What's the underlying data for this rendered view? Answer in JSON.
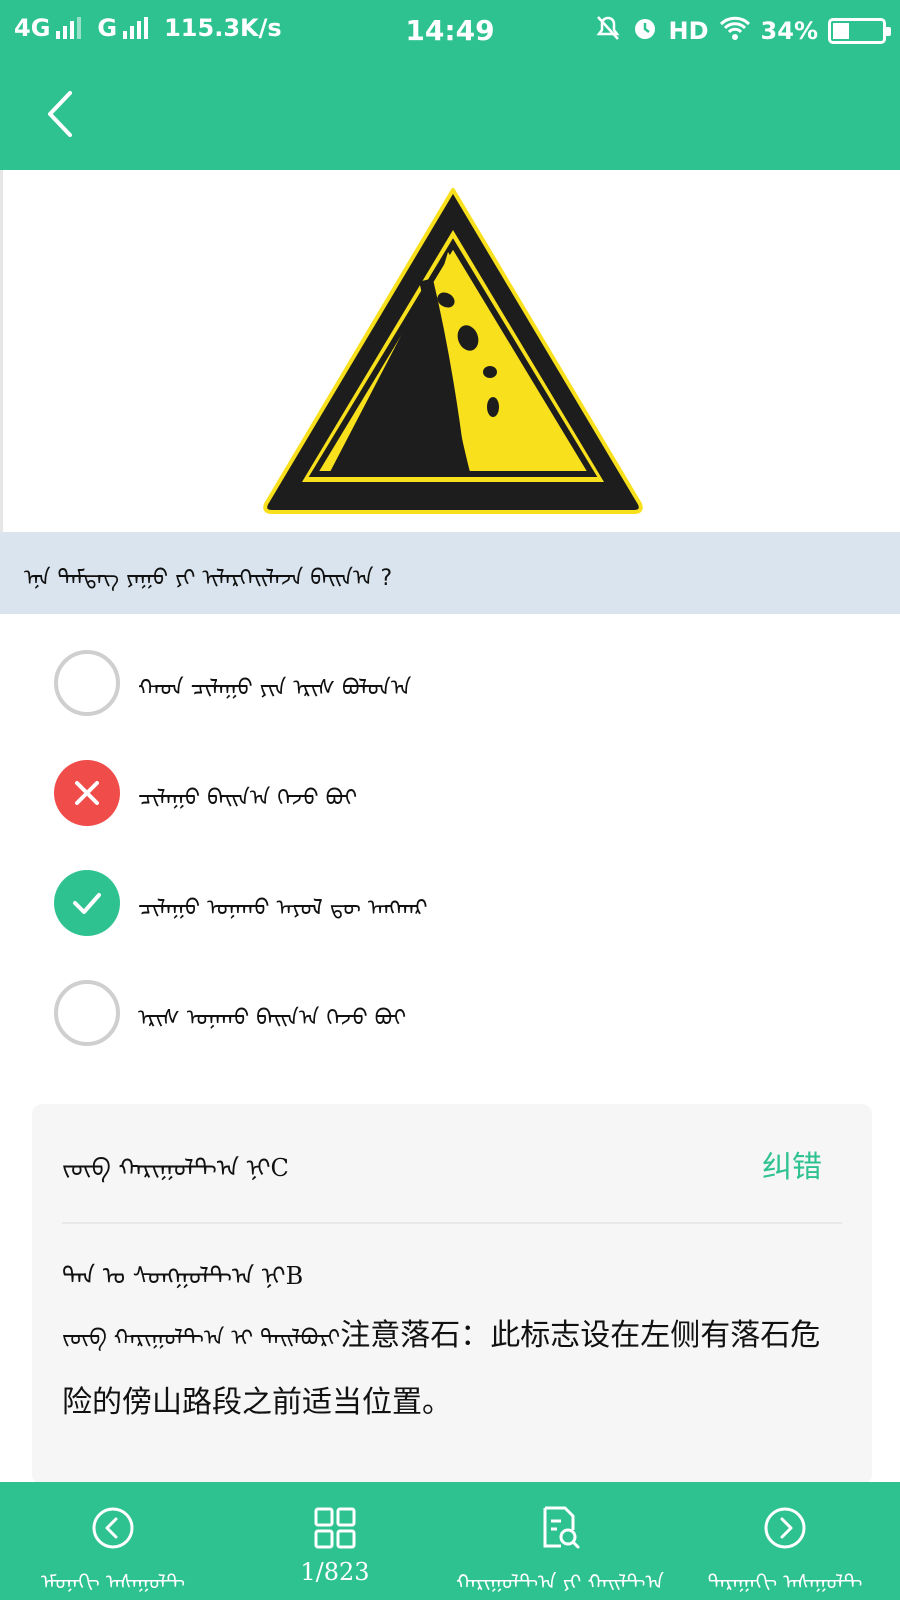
{
  "status_bar": {
    "network_1": "4G",
    "network_2": "G",
    "speed": "115.3K/s",
    "time": "14:49",
    "hd": "HD",
    "battery": "34%",
    "battery_level": 0.34
  },
  "nav": {
    "back_icon": "chevron-left-icon"
  },
  "sign": {
    "icon": "falling-rocks-warning-sign",
    "colors": {
      "border": "#1a1a1a",
      "fill": "#f9e01c"
    }
  },
  "question": {
    "text": "ᠡᠨᠡ ᠲᠡᠮᠳᠡᠭ ᠶᠠᠭᠤ ᠶᠢ ᠢᠯᠡᠷᠬᠡᠢᠯᠡᠵᠡ ᠪᠠᠢᠨ᠎ᠠ ?"
  },
  "options": [
    {
      "text": "ᠬᠠᠳ ᠴᠢᠯᠠᠭᠤ ᠶᠢᠨ ᠡᠷᠢᠰ ᠪᠤᠯᠤᠨ᠎ᠠ",
      "state": "none"
    },
    {
      "text": "ᠴᠢᠯᠠᠭᠤ ᠪᠠᠢᠨ᠎ᠠ ᠭᠡᠵᠦ ᠪᠤᠢ",
      "state": "wrong"
    },
    {
      "text": "ᠴᠢᠯᠠᠭᠤ ᠤᠨᠠᠬᠤ ᠠᠶᠤᠯ ᠳᠦ ᠠᠩᠬᠠᠷ",
      "state": "correct"
    },
    {
      "text": "ᠡᠷᠢᠰ ᠤᠨᠠᠬᠤ ᠪᠠᠢᠨ᠎ᠠ ᠭᠡᠵᠦ ᠪᠤᠢ",
      "state": "none"
    }
  ],
  "explanation": {
    "answer_label": "ᠵᠥᠪ ᠬᠠᠷᠢᠭᠤᠯᠲ᠎ᠠ ᠨᠢ",
    "answer_value": "C",
    "correct_link": "纠错",
    "your_label": "ᠲᠠᠨ ᠤ ᠰᠣᠩᠭᠣᠯᠲ᠎ᠠ ᠨᠢ",
    "your_value": "B",
    "text_label": "ᠵᠥᠪ ᠬᠠᠷᠢᠭᠤᠯᠲ᠎ᠠ ᠢ ᠲᠠᠢᠯᠪᠤᠷᠢ",
    "text": "注意落石：此标志设在左侧有落石危险的傍山路段之前适当位置。"
  },
  "bottom_nav": {
    "prev_label": "ᠡᠮᠤᠨᠡᠬᠢ ᠠᠰᠠᠭᠤᠯᠲ",
    "count": "1/823",
    "search_label": "ᠬᠠᠷᠢᠭᠤᠯᠲ᠎ᠠ ᠶᠢ ᠬᠠᠢᠯᠲ᠎ᠠ",
    "next_label": "ᠳᠠᠷᠠᠭᠠᠬᠢ ᠠᠰᠠᠭᠤᠯᠲ"
  }
}
